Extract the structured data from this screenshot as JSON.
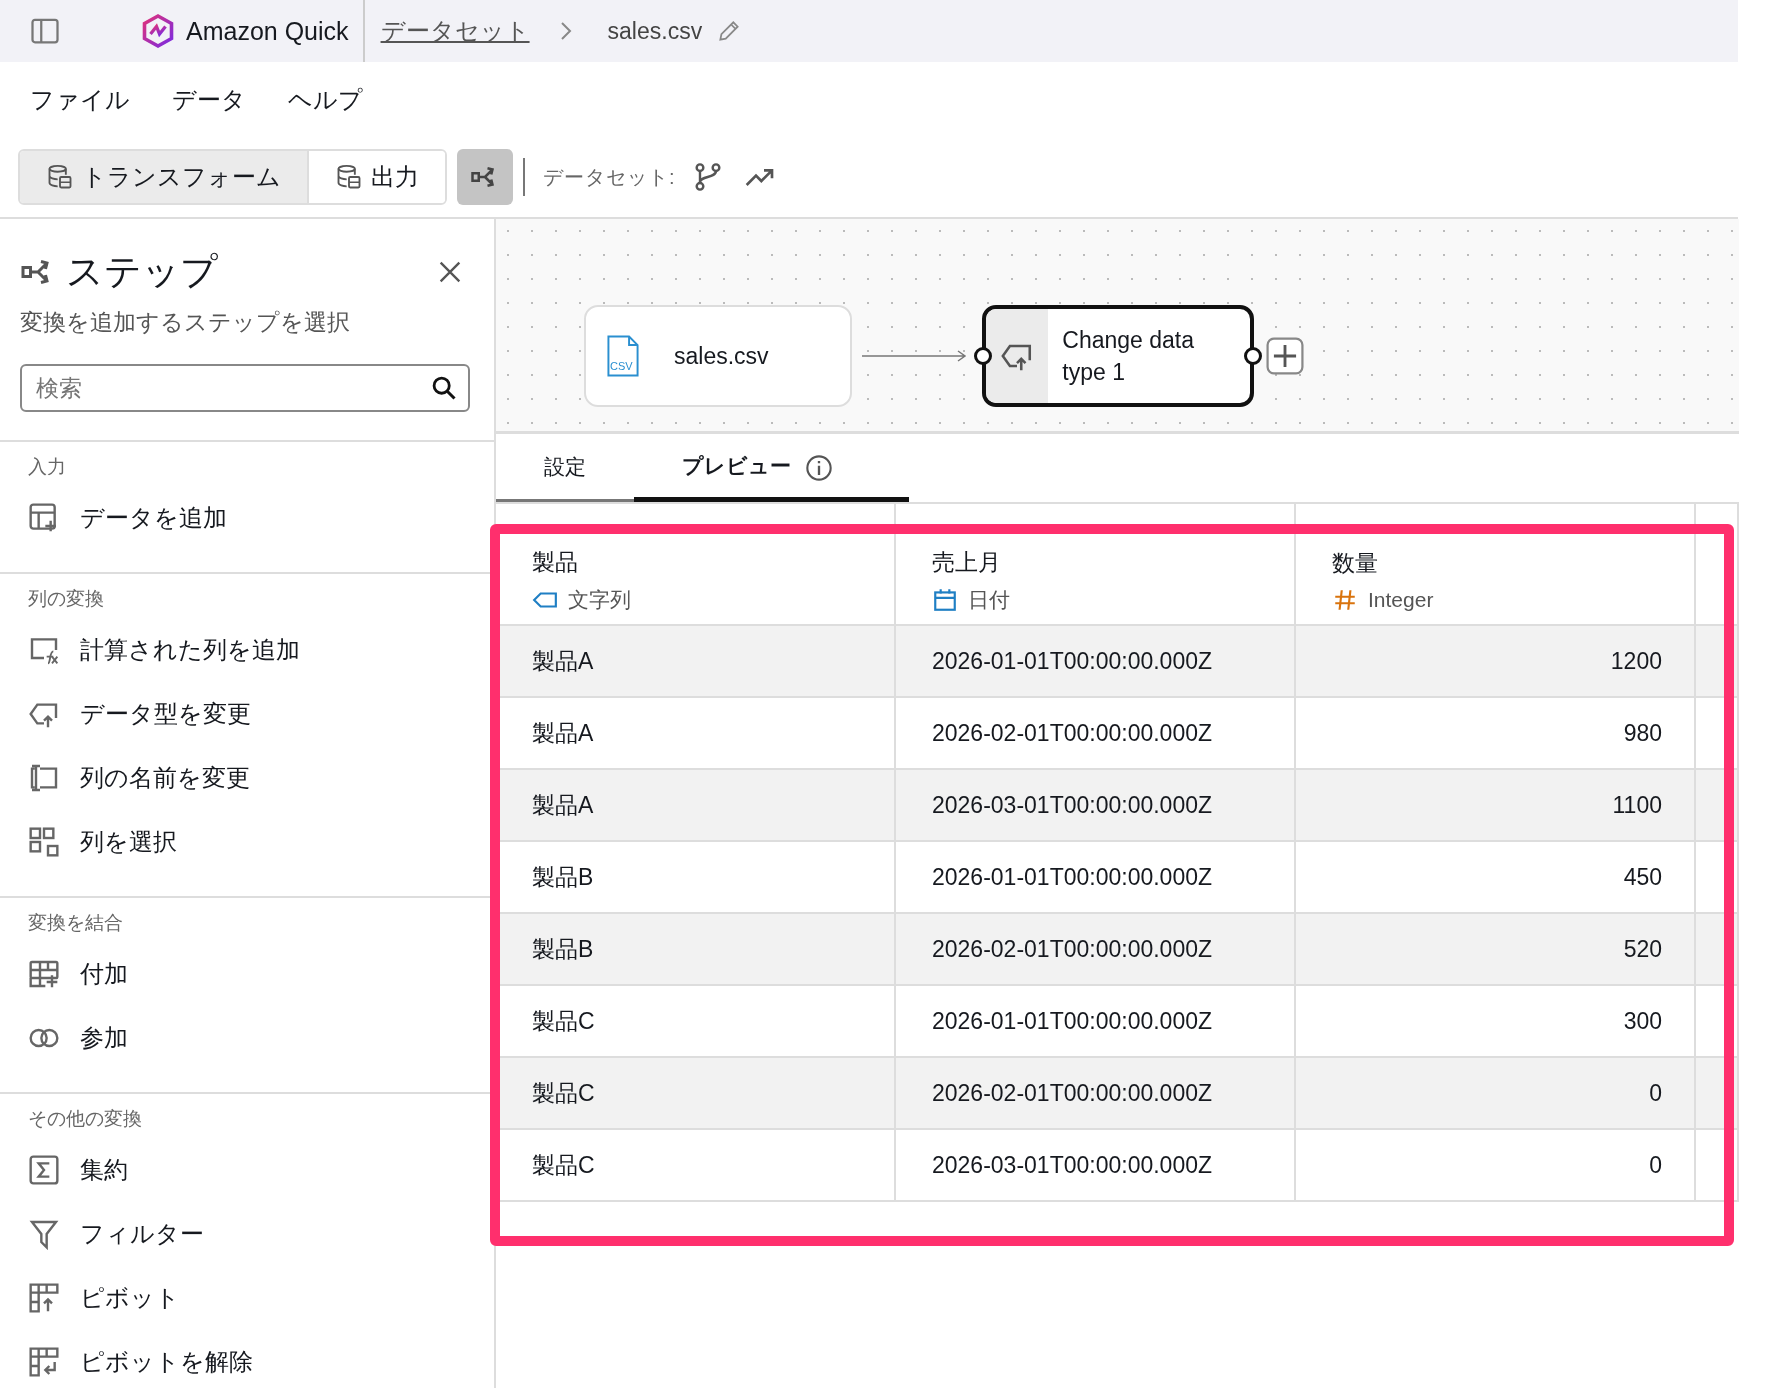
{
  "app": {
    "name": "Amazon Quick"
  },
  "breadcrumb": {
    "parent": "データセット",
    "current": "sales.csv"
  },
  "menu": [
    "ファイル",
    "データ",
    "ヘルプ"
  ],
  "toolbar": {
    "tabs": [
      {
        "label": "トランスフォーム",
        "selected": true
      },
      {
        "label": "出力",
        "selected": false
      }
    ],
    "flow_button_selected": true,
    "dataset_label": "データセット:"
  },
  "steps_panel": {
    "title": "ステップ",
    "subtitle": "変換を追加するステップを選択",
    "search": {
      "placeholder": "検索"
    },
    "sections": [
      {
        "label": "入力",
        "items": [
          {
            "label": "データを追加",
            "kind": "add-data"
          }
        ]
      },
      {
        "label": "列の変換",
        "items": [
          {
            "label": "計算された列を追加",
            "kind": "calc"
          },
          {
            "label": "データ型を変更",
            "kind": "type"
          },
          {
            "label": "列の名前を変更",
            "kind": "rename"
          },
          {
            "label": "列を選択",
            "kind": "select"
          }
        ]
      },
      {
        "label": "変換を結合",
        "items": [
          {
            "label": "付加",
            "kind": "append"
          },
          {
            "label": "参加",
            "kind": "join"
          }
        ]
      },
      {
        "label": "その他の変換",
        "items": [
          {
            "label": "集約",
            "kind": "aggregate"
          },
          {
            "label": "フィルター",
            "kind": "filter"
          },
          {
            "label": "ピボット",
            "kind": "pivot"
          },
          {
            "label": "ピボットを解除",
            "kind": "unpivot"
          }
        ]
      }
    ]
  },
  "flow": {
    "nodes": [
      {
        "label": "sales.csv",
        "kind": "source",
        "selected": false,
        "icon_text": "CSV"
      },
      {
        "label": "Change data type 1",
        "kind": "transform",
        "selected": true
      }
    ]
  },
  "detail_tabs": [
    {
      "label": "設定",
      "selected": false
    },
    {
      "label": "プレビュー",
      "selected": true
    }
  ],
  "table": {
    "columns": [
      {
        "name": "製品",
        "type": "文字列",
        "kind": "string"
      },
      {
        "name": "売上月",
        "type": "日付",
        "kind": "date"
      },
      {
        "name": "数量",
        "type": "Integer",
        "kind": "integer"
      }
    ],
    "rows": [
      [
        "製品A",
        "2026-01-01T00:00:00.000Z",
        "1200"
      ],
      [
        "製品A",
        "2026-02-01T00:00:00.000Z",
        "980"
      ],
      [
        "製品A",
        "2026-03-01T00:00:00.000Z",
        "1100"
      ],
      [
        "製品B",
        "2026-01-01T00:00:00.000Z",
        "450"
      ],
      [
        "製品B",
        "2026-02-01T00:00:00.000Z",
        "520"
      ],
      [
        "製品C",
        "2026-01-01T00:00:00.000Z",
        "300"
      ],
      [
        "製品C",
        "2026-02-01T00:00:00.000Z",
        "0"
      ],
      [
        "製品C",
        "2026-03-01T00:00:00.000Z",
        "0"
      ]
    ]
  }
}
